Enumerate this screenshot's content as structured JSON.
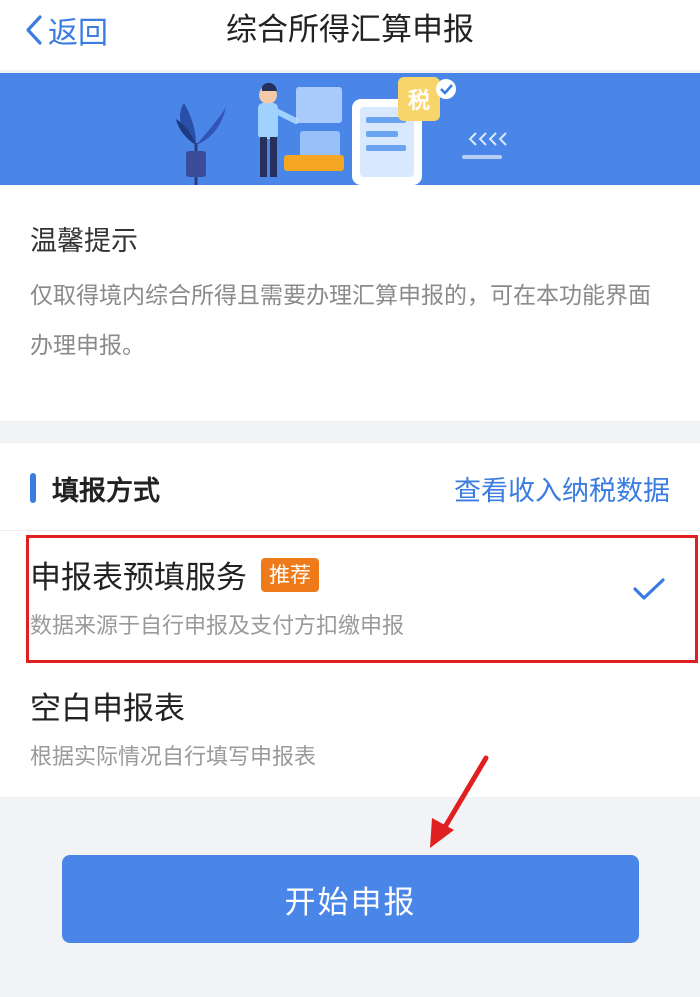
{
  "nav": {
    "back_label": "返回",
    "title": "综合所得汇算申报"
  },
  "banner": {
    "tax_char": "税"
  },
  "tips": {
    "title": "温馨提示",
    "text": "仅取得境内综合所得且需要办理汇算申报的，可在本功能界面办理申报。"
  },
  "filing": {
    "title": "填报方式",
    "link": "查看收入纳税数据",
    "options": [
      {
        "title": "申报表预填服务",
        "badge": "推荐",
        "desc": "数据来源于自行申报及支付方扣缴申报",
        "selected": true
      },
      {
        "title": "空白申报表",
        "desc": "根据实际情况自行填写申报表",
        "selected": false
      }
    ]
  },
  "submit_label": "开始申报",
  "colors": {
    "accent": "#3a7ce0",
    "banner": "#4a86e8",
    "badge": "#ef7a1a",
    "highlight": "#e02020"
  }
}
